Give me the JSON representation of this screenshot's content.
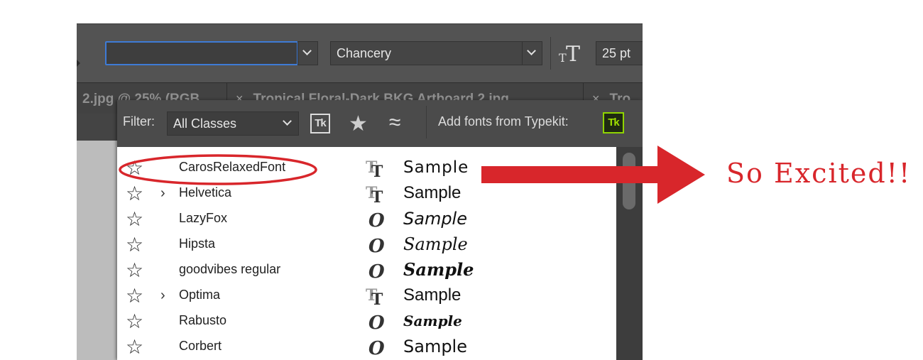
{
  "options_bar": {
    "font_family_value": "",
    "font_style_value": "Chancery",
    "font_size_value": "25 pt"
  },
  "tabs": [
    {
      "label": "2.jpg @ 25% (RGB",
      "close": ""
    },
    {
      "label": "Tropical Floral-Dark BKG Artboard 2.jpg",
      "close": "×"
    },
    {
      "label": "Tro",
      "close": "×"
    }
  ],
  "font_panel": {
    "filter_label": "Filter:",
    "filter_value": "All Classes",
    "typekit_filter_label": "Tk",
    "add_fonts_label": "Add fonts from Typekit:",
    "typekit_button_label": "Tk",
    "fonts": [
      {
        "name": "CarosRelaxedFont",
        "sample": "Sample",
        "type": "truetype",
        "expandable": false
      },
      {
        "name": "Helvetica",
        "sample": "Sample",
        "type": "truetype",
        "expandable": true
      },
      {
        "name": "LazyFox",
        "sample": "Sample",
        "type": "opentype",
        "expandable": false
      },
      {
        "name": "Hipsta",
        "sample": "Sample",
        "type": "opentype",
        "expandable": false
      },
      {
        "name": "goodvibes regular",
        "sample": "Sample",
        "type": "opentype",
        "expandable": false
      },
      {
        "name": "Optima",
        "sample": "Sample",
        "type": "truetype",
        "expandable": true
      },
      {
        "name": "Rabusto",
        "sample": "Sample",
        "type": "opentype",
        "expandable": false
      },
      {
        "name": "Corbert",
        "sample": "Sample",
        "type": "opentype",
        "expandable": false
      }
    ]
  },
  "annotation": {
    "text": "So Excited!!",
    "color": "#d8262b"
  },
  "colors": {
    "accent_focus": "#3e7bd6",
    "typekit_green": "#8fd400"
  }
}
